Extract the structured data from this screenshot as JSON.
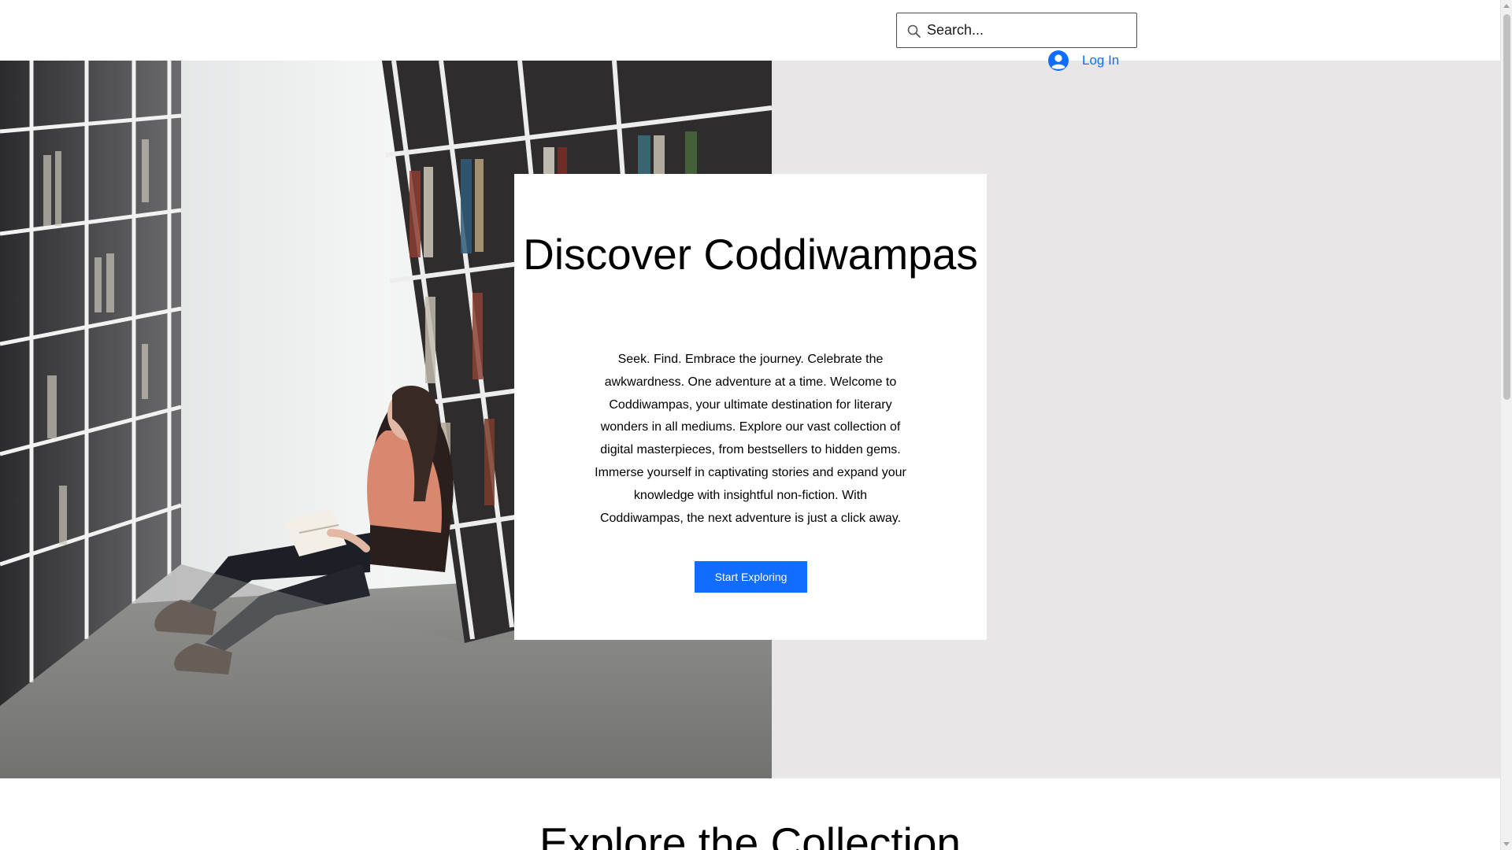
{
  "header": {
    "search": {
      "placeholder": "Search...",
      "value": ""
    },
    "login": {
      "label": "Log In"
    }
  },
  "hero": {
    "title": "Discover Coddiwampas",
    "body": "Seek. Find. Embrace the journey. Celebrate the awkwardness. One adventure at a time. Welcome to Coddiwampas, your ultimate destination for literary wonders in all mediums. Explore our vast collection of digital masterpieces, from bestsellers to hidden gems. Immerse yourself in captivating stories and expand your knowledge with insightful non-fiction. With Coddiwampas, the next adventure is just a click away.",
    "cta_label": "Start Exploring"
  },
  "collection": {
    "title": "Explore the Collection"
  },
  "colors": {
    "accent": "#116dff",
    "hero_background": "#e8e6e6",
    "card_background": "#ffffff"
  },
  "icons": {
    "search": "search-icon",
    "login": "user-avatar-icon"
  }
}
